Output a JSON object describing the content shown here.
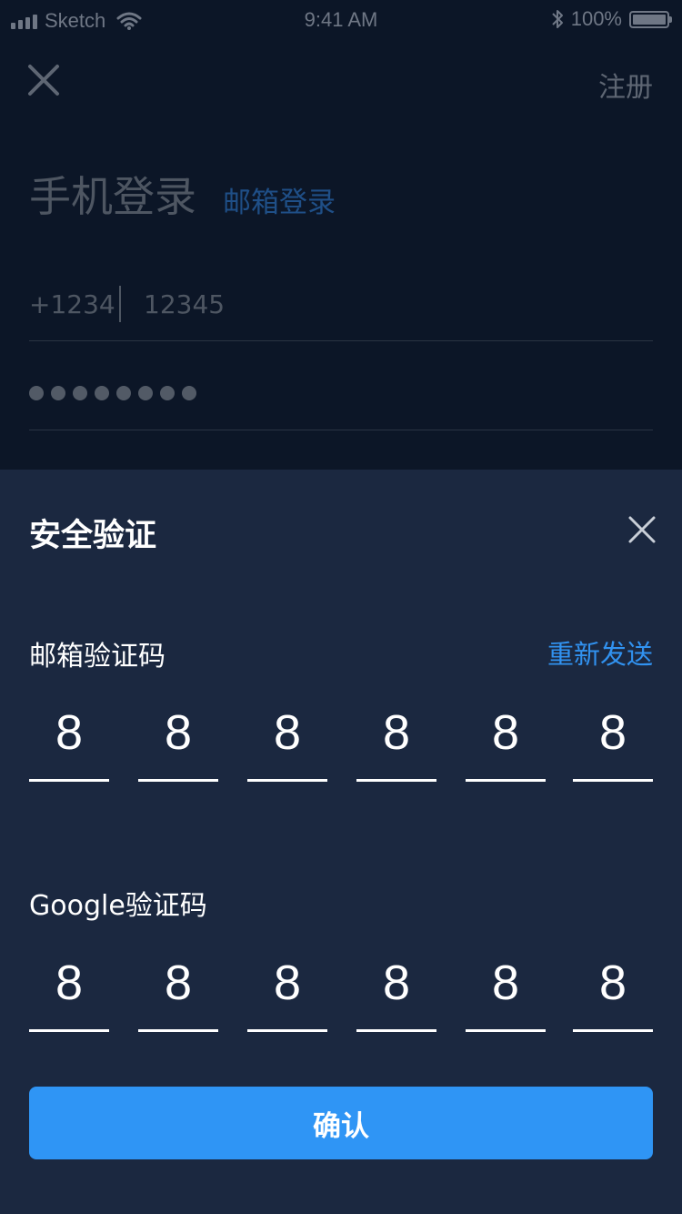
{
  "status_bar": {
    "carrier": "Sketch",
    "time": "9:41 AM",
    "battery_percent": "100%",
    "battery_level": 1.0,
    "icons": [
      "signal-icon",
      "wifi-icon",
      "bluetooth-icon",
      "battery-icon"
    ]
  },
  "login": {
    "close_icon": "close-icon",
    "register_label": "注册",
    "title": "手机登录",
    "email_tab_label": "邮箱登录",
    "country_code": "+1234",
    "phone_value": "12345",
    "password_masked": "●●●●●●●●"
  },
  "verify_sheet": {
    "title": "安全验证",
    "close_icon": "close-icon",
    "email_code_label": "邮箱验证码",
    "resend_label": "重新发送",
    "email_code_digits": [
      "8",
      "8",
      "8",
      "8",
      "8",
      "8"
    ],
    "google_code_label": "Google验证码",
    "google_code_digits": [
      "8",
      "8",
      "8",
      "8",
      "8",
      "8"
    ],
    "confirm_label": "确认"
  },
  "colors": {
    "background": "#0c1627",
    "sheet_background": "#1b2840",
    "accent": "#2f95f5",
    "link_blue": "#3192f0",
    "muted_text": "#4e5662"
  }
}
